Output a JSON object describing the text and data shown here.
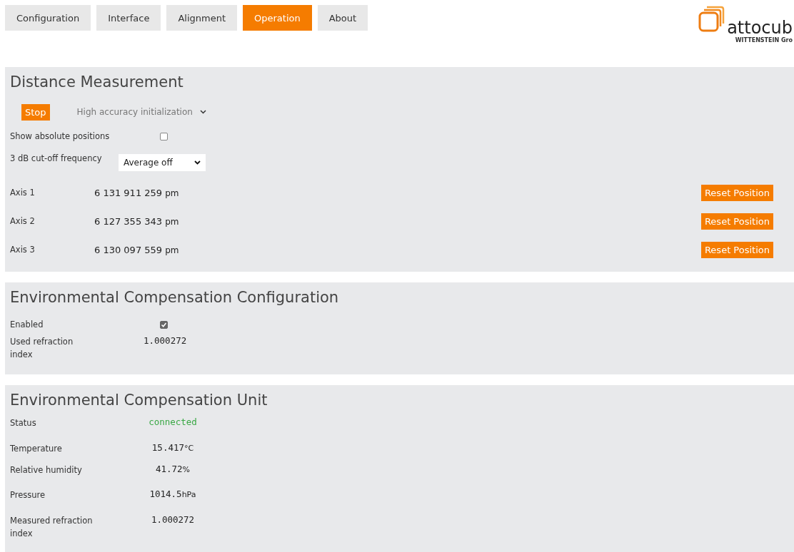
{
  "tabs": [
    {
      "label": "Configuration",
      "selected": false
    },
    {
      "label": "Interface",
      "selected": false
    },
    {
      "label": "Alignment",
      "selected": false
    },
    {
      "label": "Operation",
      "selected": true
    },
    {
      "label": "About",
      "selected": false
    }
  ],
  "logo": {
    "name": "attocub",
    "tagline": "WITTENSTEIN Gro"
  },
  "distance_measurement": {
    "title": "Distance Measurement",
    "stop_button": "Stop",
    "mode_select": "High accuracy initialization",
    "show_absolute": {
      "label": "Show absolute positions",
      "checked": false
    },
    "cutoff": {
      "label": "3 dB cut-off frequency",
      "value": "Average off"
    },
    "axes": [
      {
        "label": "Axis 1",
        "value": "6 131 911 259",
        "unit": "pm",
        "button": "Reset Position"
      },
      {
        "label": "Axis 2",
        "value": "6 127 355 343",
        "unit": "pm",
        "button": "Reset Position"
      },
      {
        "label": "Axis 3",
        "value": "6 130 097 559",
        "unit": "pm",
        "button": "Reset Position"
      }
    ]
  },
  "environmental_compensation_configuration": {
    "title": "Environmental Compensation Configuration",
    "enabled": {
      "label": "Enabled",
      "checked": true
    },
    "refraction": {
      "label": "Used refraction index",
      "value": "1.000272"
    }
  },
  "environmental_compensation_unit": {
    "title": "Environmental Compensation Unit",
    "rows": [
      {
        "kind": "status",
        "label": "Status",
        "value": "connected"
      },
      {
        "kind": "reading",
        "label": "Temperature",
        "value": "15.417",
        "unit": "°C"
      },
      {
        "kind": "reading",
        "label": "Relative humidity",
        "value": "41.72",
        "unit": "%"
      },
      {
        "kind": "reading",
        "label": "Pressure",
        "value": "1014.5",
        "unit": "hPa"
      },
      {
        "kind": "reading",
        "label": "Measured refraction index",
        "value": "1.000272"
      }
    ]
  }
}
